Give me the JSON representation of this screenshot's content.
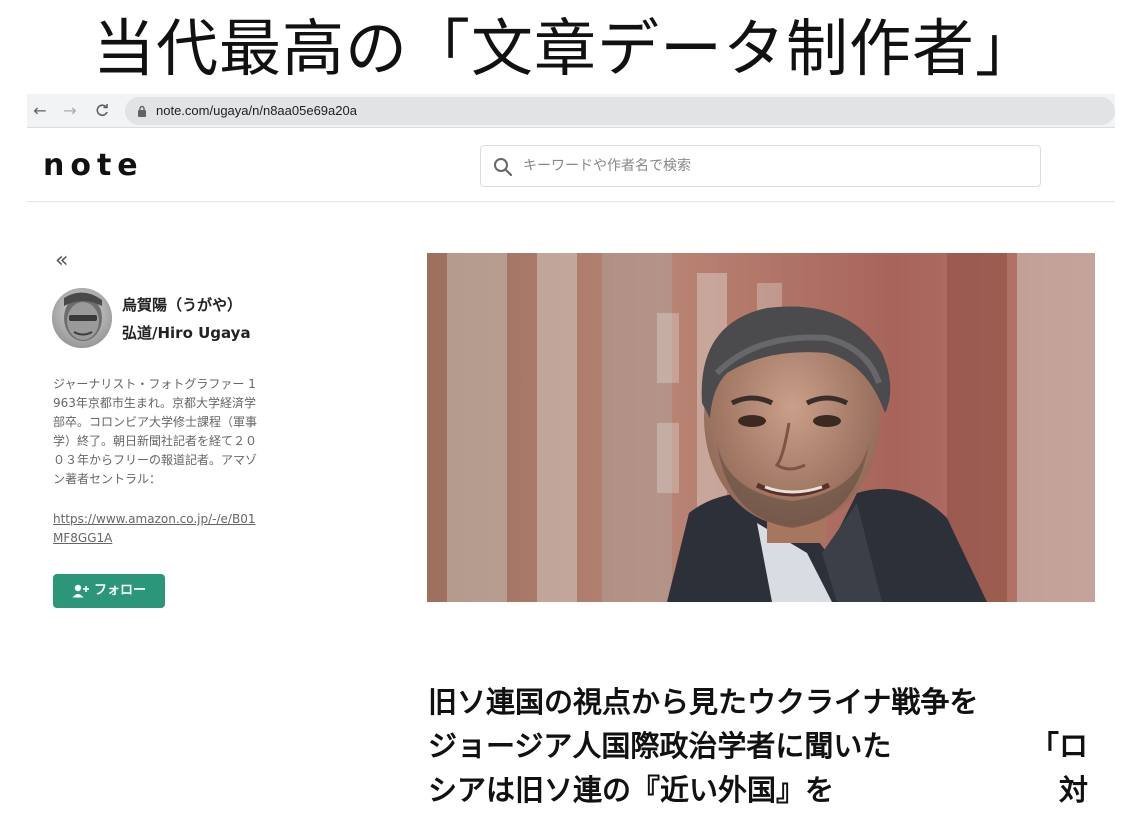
{
  "banner": {
    "title": "当代最高の「文章データ制作者」"
  },
  "browser": {
    "back_icon": "←",
    "forward_icon": "→",
    "reload_icon": "C",
    "url": "note.com/ugaya/n/n8aa05e69a20a"
  },
  "header": {
    "logo": "note",
    "search_placeholder": "キーワードや作者名で検索"
  },
  "sidebar": {
    "collapse_icon": "«",
    "author_name_line1": "烏賀陽（うがや）",
    "author_name_line2": "弘道/Hiro Ugaya",
    "bio": "ジャーナリスト・フォトグラファー 1963年京都市生まれ。京都大学経済学部卒。コロンビア大学修士課程（軍事学）終了。朝日新聞社記者を経て２００３年からフリーの報道記者。アマゾン著者セントラル：",
    "bio_link": "https://www.amazon.co.jp/-/e/B01MF8GG1A",
    "follow_label": "フォロー",
    "accent_color": "#2b9679"
  },
  "article": {
    "title_line1": "旧ソ連国の視点から見たウクライナ戦争を",
    "title_line2_left": "ジョージア人国際政治学者に聞いた",
    "title_line2_right": "「ロ",
    "title_line3_left": "シアは旧ソ連の『近い外国』を",
    "title_line3_right": "対"
  }
}
